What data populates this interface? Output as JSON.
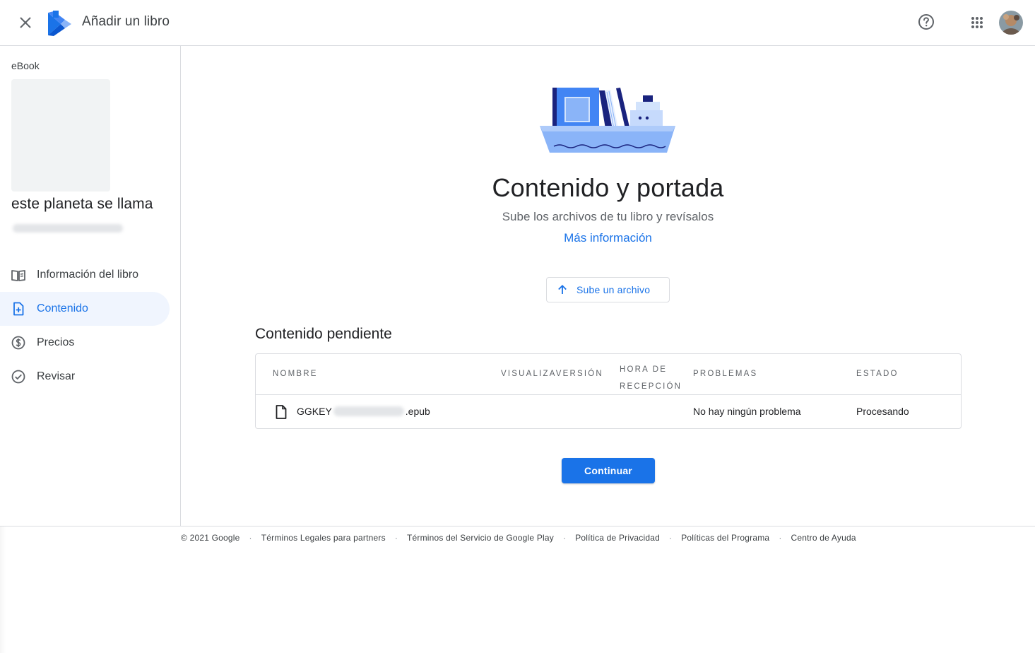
{
  "header": {
    "title": "Añadir un libro",
    "close_icon": "close-icon",
    "help_icon": "help-circle-icon",
    "apps_icon": "apps-grid-icon"
  },
  "sidebar": {
    "book_type": "eBook",
    "book_title": "este planeta se llama",
    "items": [
      {
        "label": "Información del libro",
        "icon": "book-info-icon"
      },
      {
        "label": "Contenido",
        "icon": "content-file-icon"
      },
      {
        "label": "Precios",
        "icon": "dollar-circle-icon"
      },
      {
        "label": "Revisar",
        "icon": "check-circle-icon"
      }
    ]
  },
  "main": {
    "title": "Contenido y portada",
    "subtitle": "Sube los archivos de tu libro y revísalos",
    "more_link": "Más información",
    "upload_label": "Sube un archivo",
    "section_title": "Contenido pendiente",
    "table": {
      "headers": [
        "Nombre",
        "Visualizaversión",
        "Hora de recepción",
        "Problemas",
        "Estado"
      ],
      "rows": [
        {
          "name_prefix": "GGKEY",
          "name_suffix": ".epub",
          "problems": "No hay ningún problema",
          "status": "Procesando"
        }
      ]
    },
    "continue_label": "Continuar"
  },
  "footer": {
    "copyright": "© 2021 Google",
    "links": [
      "Términos Legales para partners",
      "Términos del Servicio de Google Play",
      "Política de Privacidad",
      "Políticas del Programa",
      "Centro de Ayuda"
    ]
  },
  "colors": {
    "accent": "#1a73e8",
    "border": "#dadce0",
    "nav_selected_bg": "#f0f5fe"
  }
}
